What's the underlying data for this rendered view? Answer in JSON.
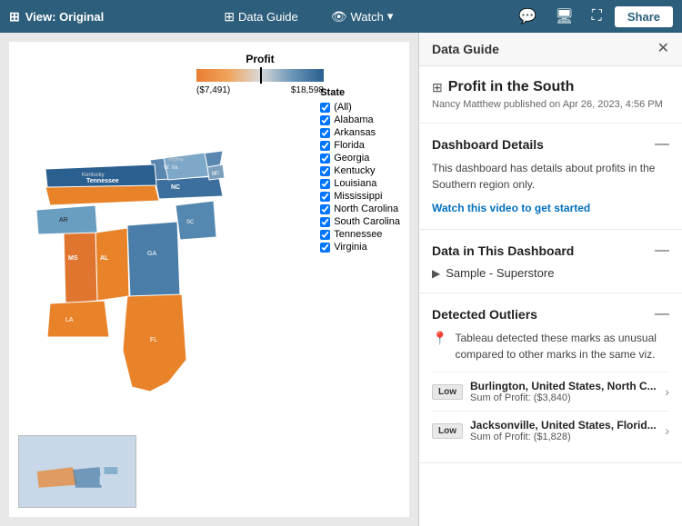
{
  "topbar": {
    "view_label": "View: Original",
    "data_guide_label": "Data Guide",
    "watch_label": "Watch",
    "share_label": "Share"
  },
  "legend": {
    "title": "Profit",
    "min_label": "($7,491)",
    "max_label": "$18,598"
  },
  "state_filter": {
    "title": "State",
    "states": [
      "(All)",
      "Alabama",
      "Arkansas",
      "Florida",
      "Georgia",
      "Kentucky",
      "Louisiana",
      "Mississippi",
      "North Carolina",
      "South Carolina",
      "Tennessee",
      "Virginia"
    ]
  },
  "data_guide": {
    "panel_title": "Data Guide",
    "dashboard_title": "Profit in the South",
    "published_info": "Nancy Matthew published on Apr 26, 2023, 4:56 PM",
    "dashboard_details_title": "Dashboard Details",
    "dashboard_desc": "This dashboard has details about profits in the Southern region only.",
    "watch_link_label": "Watch this video to get started",
    "data_section_title": "Data in This Dashboard",
    "data_source": "Sample - Superstore",
    "outliers_title": "Detected Outliers",
    "outlier_intro": "Tableau detected these marks as unusual compared to other marks in the same viz.",
    "outliers": [
      {
        "badge": "Low",
        "name": "Burlington, United States, North C...",
        "value": "Sum of Profit: ($3,840)"
      },
      {
        "badge": "Low",
        "name": "Jacksonville, United States, Florid...",
        "value": "Sum of Profit: ($1,828)"
      }
    ]
  }
}
